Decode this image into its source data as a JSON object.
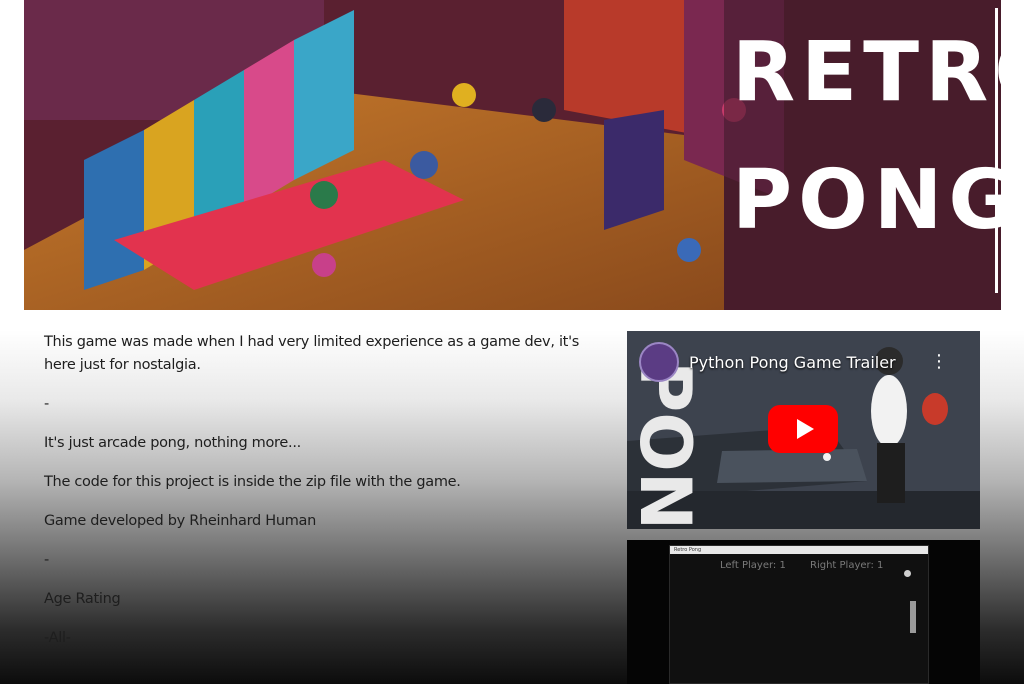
{
  "banner": {
    "title_line1": "RETRO",
    "title_line2": "PONG"
  },
  "description": {
    "paragraphs": [
      "This game was made when I had very limited experience as a game dev, it's here just for nostalgia.",
      "-",
      "It's just arcade pong, nothing more...",
      "The code for this project is inside the zip file with the game.",
      "Game developed by Rheinhard Human",
      "-",
      "Age Rating",
      "-All-"
    ]
  },
  "video": {
    "title": "Python Pong Game Trailer",
    "menu_icon": "more-vertical-icon",
    "play_icon": "play-icon",
    "play_color": "#ff0000",
    "side_text": "PONG"
  },
  "screenshot": {
    "window_title": "Retro Pong",
    "left_score": "Left Player: 1",
    "right_score": "Right Player: 1"
  }
}
